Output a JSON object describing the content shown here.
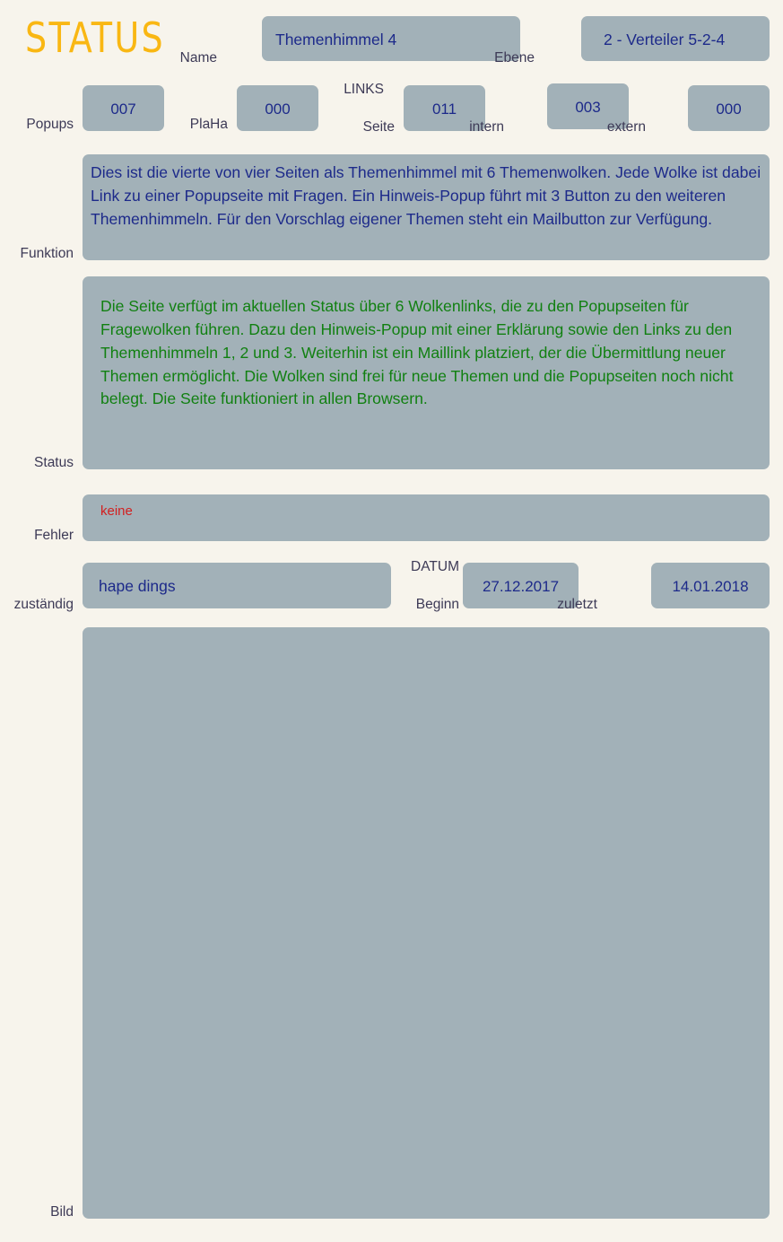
{
  "header": {
    "title": "STATUS",
    "title_color": "#f9b713",
    "name_label": "Name",
    "name_value": "Themenhimmel 4",
    "ebene_label": "Ebene",
    "ebene_value": "2 - Verteiler 5-2-4"
  },
  "counters": {
    "links_group_label": "LINKS",
    "popups_label": "Popups",
    "popups_value": "007",
    "plaha_label": "PlaHa",
    "plaha_value": "000",
    "seite_label": "Seite",
    "seite_value": "011",
    "intern_label": "intern",
    "intern_value": "003",
    "extern_label": "extern",
    "extern_value": "000"
  },
  "funktion": {
    "label": "Funktion",
    "text": "Dies ist die vierte von vier Seiten als Themenhimmel mit 6 Themenwolken. Jede Wolke ist dabei Link zu einer Popupseite mit Fragen. Ein Hinweis-Popup führt mit 3 Button zu den weiteren Themenhimmeln. Für den Vorschlag eigener Themen steht ein Mailbutton zur Verfügung.",
    "text_color": "#1d2a8a"
  },
  "status": {
    "label": "Status",
    "text": "Die Seite verfügt im aktuellen Status über 6 Wolkenlinks, die zu den Popupseiten für Fragewolken führen. Dazu den Hinweis-Popup mit einer Erklärung sowie den Links zu den Themenhimmeln 1, 2 und 3. Weiterhin ist ein Maillink platziert, der die Übermittlung neuer Themen ermöglicht. Die Wolken sind frei für neue Themen und die Popupseiten noch nicht belegt. Die Seite funktioniert in allen Browsern.",
    "text_color": "#118011"
  },
  "fehler": {
    "label": "Fehler",
    "text": "keine",
    "text_color": "#d22020"
  },
  "zustaendig": {
    "label": "zuständig",
    "value": "hape dings",
    "datum_group_label": "DATUM",
    "beginn_label": "Beginn",
    "beginn_value": "27.12.2017",
    "zuletzt_label": "zuletzt",
    "zuletzt_value": "14.01.2018"
  },
  "bild": {
    "label": "Bild",
    "content": ""
  },
  "theme": {
    "page_background": "#f7f4ec",
    "field_background": "#a2b1b8",
    "label_color": "#3d3a56",
    "value_color": "#1d2a8a"
  }
}
